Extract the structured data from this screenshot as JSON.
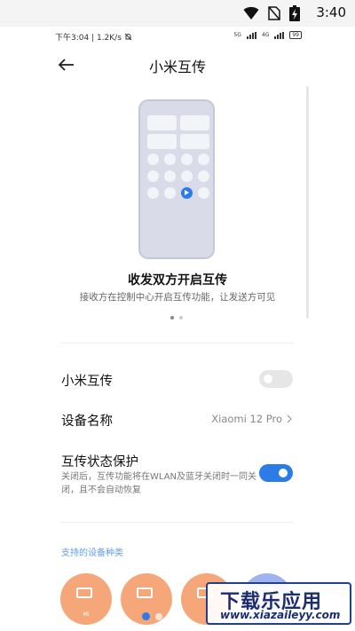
{
  "status_bar": {
    "time": "3:40",
    "icons": [
      "wifi-icon",
      "no-sim-icon",
      "battery-charging-icon"
    ]
  },
  "inner_status_bar": {
    "left": "下午3:04 | 1.2K/s",
    "bell_icon": "bell-muted-icon",
    "net_labels": [
      "5G",
      "4G"
    ],
    "battery": "99"
  },
  "header": {
    "back_icon": "arrow-left-icon",
    "title": "小米互传"
  },
  "hero": {
    "title": "收发双方开启互传",
    "subtitle": "接收方在控制中心开启互传功能，让发送方可见",
    "pager": {
      "count": 2,
      "active": 0
    }
  },
  "settings": {
    "mi_share": {
      "label": "小米互传",
      "enabled": false
    },
    "device_name": {
      "label": "设备名称",
      "value": "Xiaomi 12 Pro"
    },
    "protection": {
      "label": "互传状态保护",
      "description": "关闭后，互传功能将在WLAN及蓝牙关闭时一同关闭，且不会自动恢复",
      "enabled": true
    }
  },
  "devices": {
    "section_title": "支持的设备种类",
    "items": [
      {
        "name": "Mi",
        "color": "#f6a77a"
      },
      {
        "name": "",
        "color": "#f6a77a"
      },
      {
        "name": "",
        "color": "#f6a77a"
      },
      {
        "name": "",
        "color": "#9fb3ee"
      }
    ],
    "pager": {
      "count": 4,
      "active": 0
    }
  },
  "watermark": {
    "main": "下载乐应用",
    "url": "www.xiazaileyy.com"
  },
  "colors": {
    "accent": "#2c7ce8",
    "device_orange": "#f6a77a",
    "phone_body": "#dadbe8"
  }
}
